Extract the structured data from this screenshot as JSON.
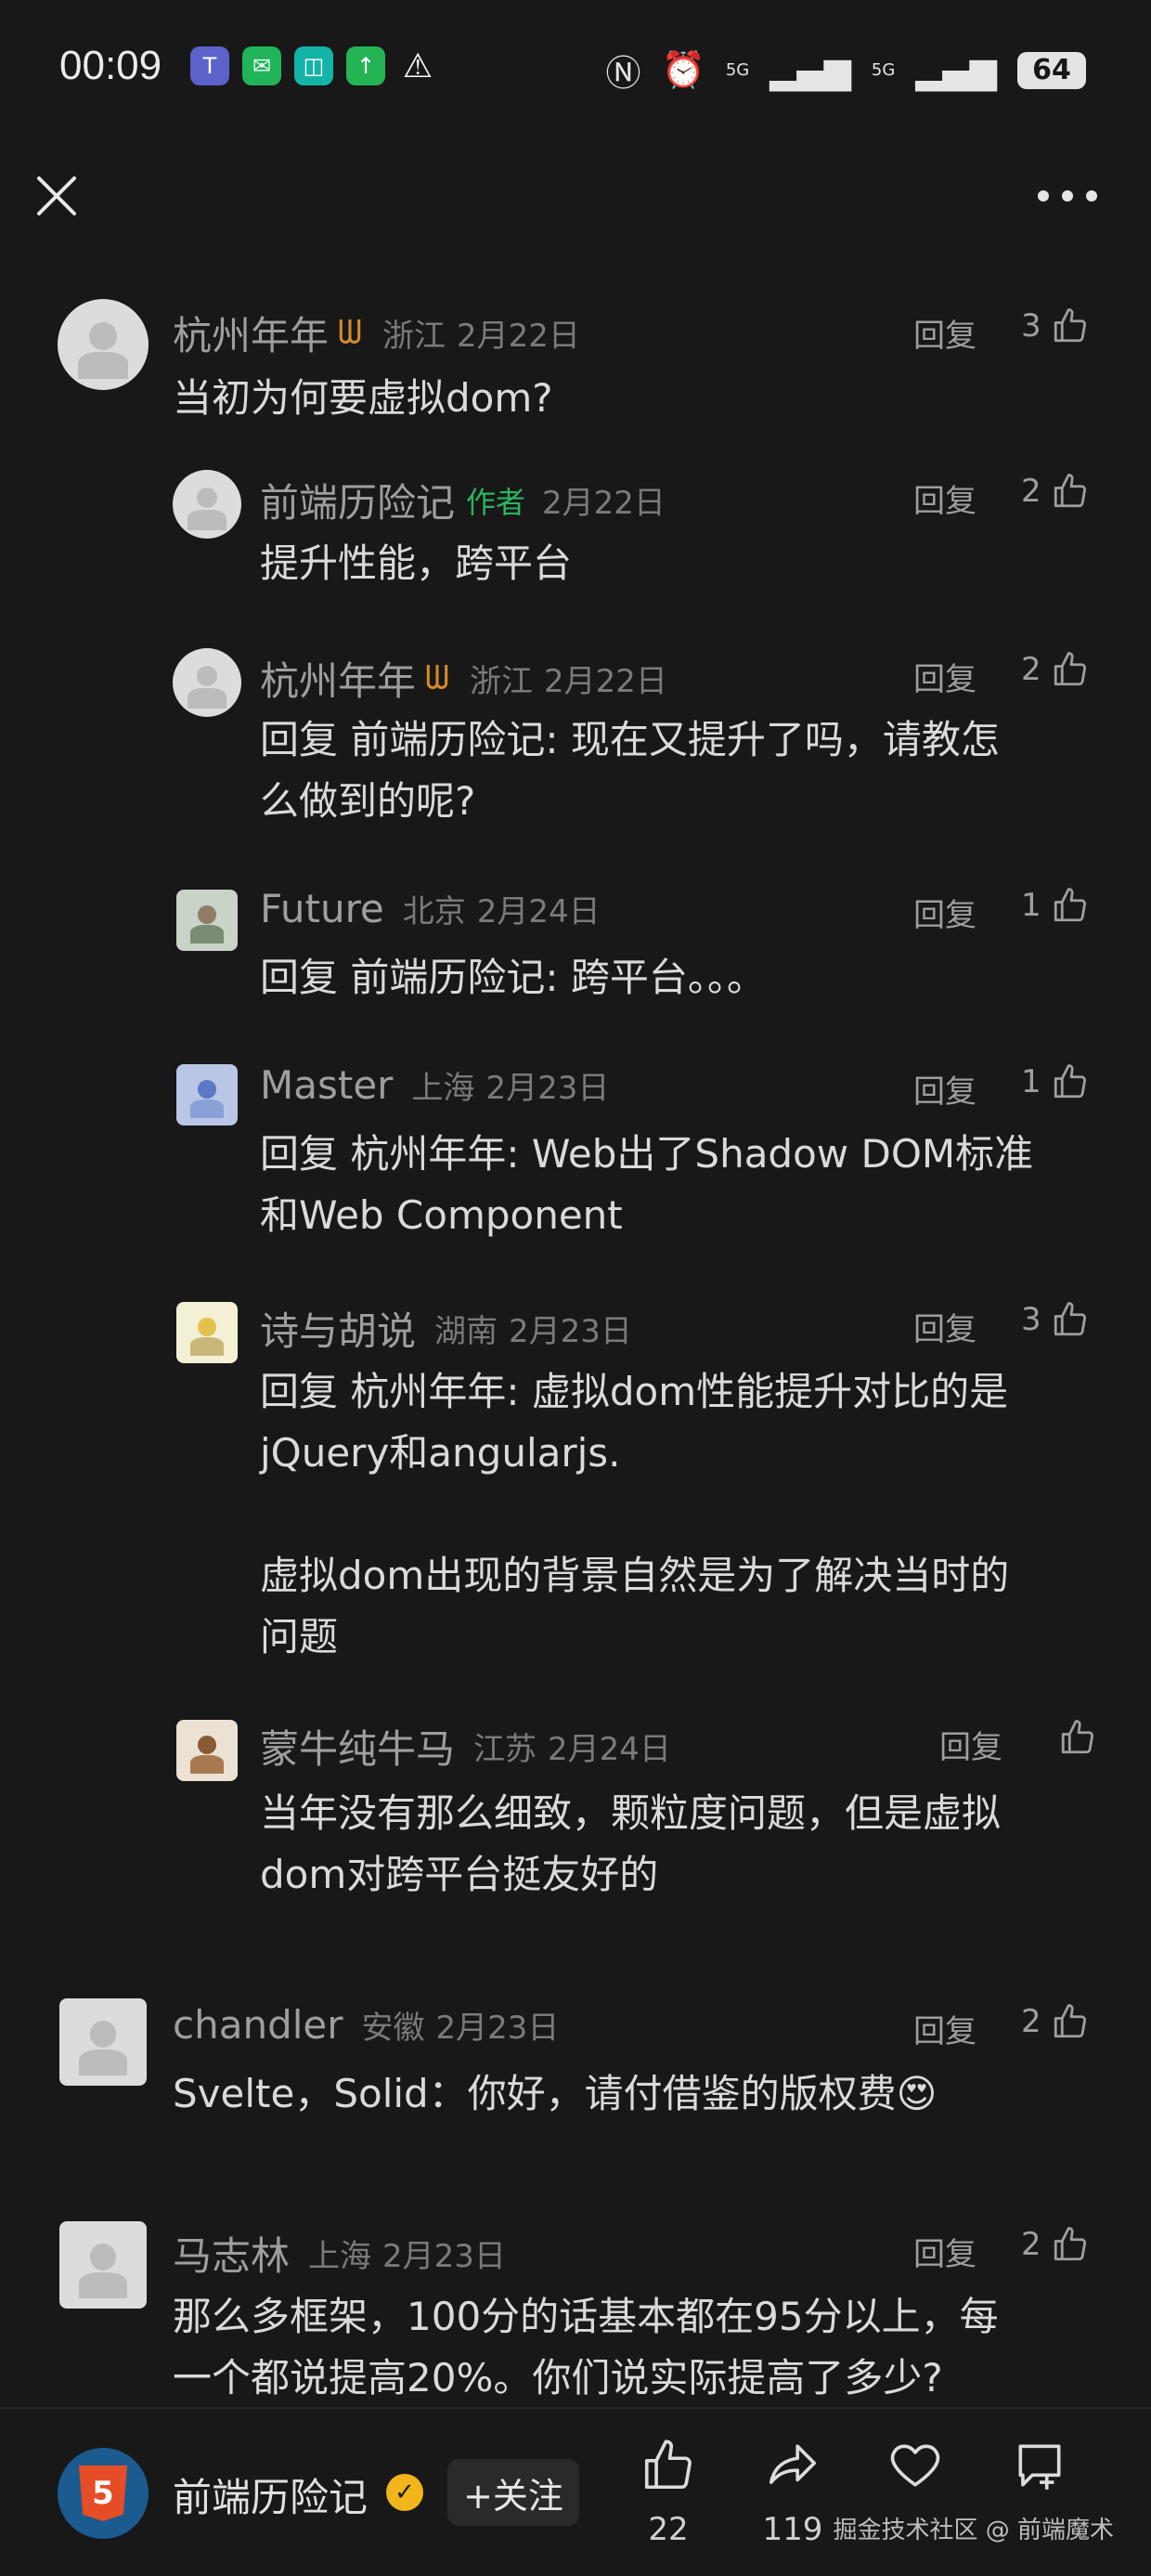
{
  "status_bar": {
    "time": "00:09",
    "left_icons": [
      "teams-icon",
      "message-icon",
      "shopping-icon",
      "upload-icon",
      "warning-icon"
    ],
    "network_labels": [
      "5G",
      "5G"
    ],
    "battery": "64"
  },
  "comments": [
    {
      "name": "杭州年年",
      "badge": "ᗯ",
      "location": "浙江",
      "date": "2月22日",
      "reply": "回复",
      "likes": "3",
      "text": "当初为何要虚拟dom?"
    },
    {
      "name": "前端历险记",
      "author_tag": "作者",
      "date": "2月22日",
      "reply": "回复",
      "likes": "2",
      "text": "提升性能，跨平台"
    },
    {
      "name": "杭州年年",
      "badge": "ᗯ",
      "location": "浙江",
      "date": "2月22日",
      "reply": "回复",
      "likes": "2",
      "text": "回复 前端历险记: 现在又提升了吗，请教怎\n么做到的呢?"
    },
    {
      "name": "Future",
      "location": "北京",
      "date": "2月24日",
      "reply": "回复",
      "likes": "1",
      "text": "回复 前端历险记: 跨平台。。。"
    },
    {
      "name": "Master",
      "location": "上海",
      "date": "2月23日",
      "reply": "回复",
      "likes": "1",
      "text": "回复 杭州年年: Web出了Shadow DOM标准\n和Web Component"
    },
    {
      "name": "诗与胡说",
      "location": "湖南",
      "date": "2月23日",
      "reply": "回复",
      "likes": "3",
      "text": "回复 杭州年年: 虚拟dom性能提升对比的是\njQuery和angularjs.\n\n虚拟dom出现的背景自然是为了解决当时的\n问题"
    },
    {
      "name": "蒙牛纯牛马",
      "location": "江苏",
      "date": "2月24日",
      "reply": "回复",
      "likes": "",
      "text": "当年没有那么细致，颗粒度问题，但是虚拟\ndom对跨平台挺友好的"
    },
    {
      "name": "chandler",
      "location": "安徽",
      "date": "2月23日",
      "reply": "回复",
      "likes": "2",
      "text": "Svelte，Solid：你好，请付借鉴的版权费😍"
    },
    {
      "name": "马志林",
      "location": "上海",
      "date": "2月23日",
      "reply": "回复",
      "likes": "2",
      "text": "那么多框架，100分的话基本都在95分以上，每\n一个都说提高20%。你们说实际提高了多少?"
    }
  ],
  "bottom_bar": {
    "author_name": "前端历险记",
    "follow_label": "+关注",
    "like_count": "22",
    "share_count": "119",
    "watermark": "掘金技术社区 @ 前端魔术"
  }
}
